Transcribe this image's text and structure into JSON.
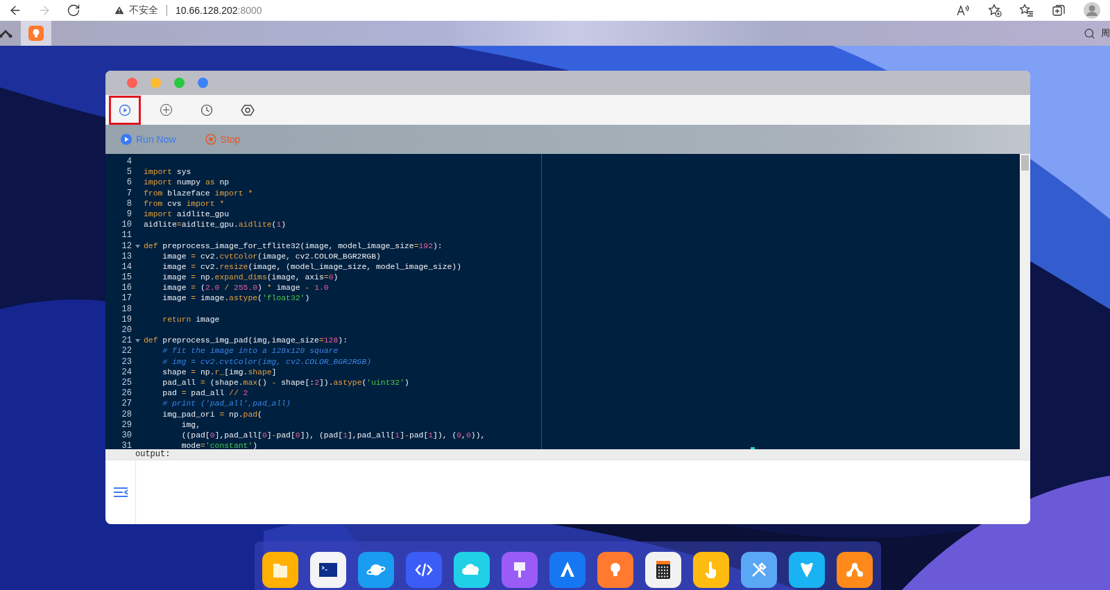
{
  "browser": {
    "nav": [
      {
        "kind": "back",
        "disabled": false
      },
      {
        "kind": "forward",
        "disabled": true
      },
      {
        "kind": "reload",
        "disabled": false
      }
    ],
    "address": {
      "security": "不安全",
      "host": "10.66.128.202",
      "port": ":8000"
    }
  },
  "tab_strip": {
    "tabs": [
      {
        "kind": "bulb",
        "selected": true
      }
    ],
    "search_text": "周"
  },
  "window": {
    "toolbar": [
      {
        "kind": "run",
        "selected": true
      },
      {
        "kind": "add",
        "selected": false
      },
      {
        "kind": "history",
        "selected": false
      },
      {
        "kind": "settings",
        "selected": false
      }
    ],
    "actions": [
      {
        "kind": "run",
        "label": "Run Now"
      },
      {
        "kind": "stop",
        "label": "Stop"
      }
    ],
    "editor": {
      "lines": [
        {
          "no": "4"
        },
        {
          "no": "5",
          "segments": [
            {
              "text": "import",
              "kind": "kw"
            },
            {
              "text": " sys"
            }
          ]
        },
        {
          "no": "6",
          "segments": [
            {
              "text": "import",
              "kind": "kw"
            },
            {
              "text": " numpy "
            },
            {
              "text": "as",
              "kind": "kw"
            },
            {
              "text": " np"
            }
          ]
        },
        {
          "no": "7",
          "segments": [
            {
              "text": "from",
              "kind": "kw"
            },
            {
              "text": " blazeface "
            },
            {
              "text": "import",
              "kind": "kw"
            },
            {
              "text": " *",
              "kind": "kw"
            }
          ]
        },
        {
          "no": "8",
          "segments": [
            {
              "text": "from",
              "kind": "kw"
            },
            {
              "text": " cvs "
            },
            {
              "text": "import",
              "kind": "kw"
            },
            {
              "text": " *",
              "kind": "kw"
            }
          ]
        },
        {
          "no": "9",
          "segments": [
            {
              "text": "import",
              "kind": "kw"
            },
            {
              "text": " aidlite_gpu"
            }
          ]
        },
        {
          "no": "10",
          "segments": [
            {
              "text": "aidlite"
            },
            {
              "text": "=",
              "kind": "kw"
            },
            {
              "text": "aidlite_gpu."
            },
            {
              "text": "aidlite",
              "kind": "kw"
            },
            {
              "text": "("
            },
            {
              "text": "1",
              "kind": "num"
            },
            {
              "text": ")"
            }
          ]
        },
        {
          "no": "11"
        },
        {
          "no": "12",
          "fold": true,
          "segments": [
            {
              "text": "def",
              "kind": "kw"
            },
            {
              "text": " preprocess_image_for_tflite32(image, model_image_size"
            },
            {
              "text": "=",
              "kind": "kw"
            },
            {
              "text": "192",
              "kind": "num"
            },
            {
              "text": "):"
            }
          ]
        },
        {
          "no": "13",
          "segments": [
            {
              "text": "    image "
            },
            {
              "text": "=",
              "kind": "kw"
            },
            {
              "text": " cv2."
            },
            {
              "text": "cvtColor",
              "kind": "kw"
            },
            {
              "text": "(image, cv2.COLOR_BGR2RGB)"
            }
          ]
        },
        {
          "no": "14",
          "segments": [
            {
              "text": "    image "
            },
            {
              "text": "=",
              "kind": "kw"
            },
            {
              "text": " cv2."
            },
            {
              "text": "resize",
              "kind": "kw"
            },
            {
              "text": "(image, (model_image_size, model_image_size))"
            }
          ]
        },
        {
          "no": "15",
          "segments": [
            {
              "text": "    image "
            },
            {
              "text": "=",
              "kind": "kw"
            },
            {
              "text": " np."
            },
            {
              "text": "expand_dims",
              "kind": "kw"
            },
            {
              "text": "(image, axis"
            },
            {
              "text": "=",
              "kind": "kw"
            },
            {
              "text": "0",
              "kind": "num"
            },
            {
              "text": ")"
            }
          ]
        },
        {
          "no": "16",
          "segments": [
            {
              "text": "    image "
            },
            {
              "text": "=",
              "kind": "kw"
            },
            {
              "text": " ("
            },
            {
              "text": "2.0",
              "kind": "num"
            },
            {
              "text": " / ",
              "kind": "kw"
            },
            {
              "text": "255.0",
              "kind": "num"
            },
            {
              "text": ") "
            },
            {
              "text": "*",
              "kind": "kw"
            },
            {
              "text": " image "
            },
            {
              "text": "-",
              "kind": "kw"
            },
            {
              "text": " 1.0",
              "kind": "num"
            }
          ]
        },
        {
          "no": "17",
          "segments": [
            {
              "text": "    image "
            },
            {
              "text": "=",
              "kind": "kw"
            },
            {
              "text": " image."
            },
            {
              "text": "astype",
              "kind": "kw"
            },
            {
              "text": "("
            },
            {
              "text": "'float32'",
              "kind": "str"
            },
            {
              "text": ")"
            }
          ]
        },
        {
          "no": "18"
        },
        {
          "no": "19",
          "segments": [
            {
              "text": "    return",
              "kind": "kw"
            },
            {
              "text": " image"
            }
          ]
        },
        {
          "no": "20"
        },
        {
          "no": "21",
          "fold": true,
          "segments": [
            {
              "text": "def",
              "kind": "kw"
            },
            {
              "text": " preprocess_img_pad(img,image_size"
            },
            {
              "text": "=",
              "kind": "kw"
            },
            {
              "text": "128",
              "kind": "num"
            },
            {
              "text": "):"
            }
          ]
        },
        {
          "no": "22",
          "segments": [
            {
              "text": "    # fit the image into a 128x128 square",
              "kind": "cm"
            }
          ]
        },
        {
          "no": "23",
          "segments": [
            {
              "text": "    # img = cv2.cvtColor(img, cv2.COLOR_BGR2RGB)",
              "kind": "cm"
            }
          ]
        },
        {
          "no": "24",
          "segments": [
            {
              "text": "    shape "
            },
            {
              "text": "=",
              "kind": "kw"
            },
            {
              "text": " np."
            },
            {
              "text": "r_",
              "kind": "kw"
            },
            {
              "text": "[img."
            },
            {
              "text": "shape",
              "kind": "kw"
            },
            {
              "text": "]"
            }
          ]
        },
        {
          "no": "25",
          "segments": [
            {
              "text": "    pad_all "
            },
            {
              "text": "=",
              "kind": "kw"
            },
            {
              "text": " (shape."
            },
            {
              "text": "max",
              "kind": "kw"
            },
            {
              "text": "() "
            },
            {
              "text": "-",
              "kind": "kw"
            },
            {
              "text": " shape[:"
            },
            {
              "text": "2",
              "kind": "num"
            },
            {
              "text": "])."
            },
            {
              "text": "astype",
              "kind": "kw"
            },
            {
              "text": "("
            },
            {
              "text": "'uint32'",
              "kind": "str"
            },
            {
              "text": ")"
            }
          ]
        },
        {
          "no": "26",
          "segments": [
            {
              "text": "    pad "
            },
            {
              "text": "=",
              "kind": "kw"
            },
            {
              "text": " pad_all "
            },
            {
              "text": "//",
              "kind": "kw"
            },
            {
              "text": " 2",
              "kind": "num"
            }
          ]
        },
        {
          "no": "27",
          "segments": [
            {
              "text": "    # print ('pad_all',pad_all)",
              "kind": "cm"
            }
          ]
        },
        {
          "no": "28",
          "segments": [
            {
              "text": "    img_pad_ori "
            },
            {
              "text": "=",
              "kind": "kw"
            },
            {
              "text": " np."
            },
            {
              "text": "pad",
              "kind": "kw"
            },
            {
              "text": "("
            }
          ]
        },
        {
          "no": "29",
          "segments": [
            {
              "text": "        img,"
            }
          ]
        },
        {
          "no": "30",
          "segments": [
            {
              "text": "        ((pad["
            },
            {
              "text": "0",
              "kind": "num"
            },
            {
              "text": "],pad_all["
            },
            {
              "text": "0",
              "kind": "num"
            },
            {
              "text": "]"
            },
            {
              "text": "-",
              "kind": "kw"
            },
            {
              "text": "pad["
            },
            {
              "text": "0",
              "kind": "num"
            },
            {
              "text": "]), (pad["
            },
            {
              "text": "1",
              "kind": "num"
            },
            {
              "text": "],pad_all["
            },
            {
              "text": "1",
              "kind": "num"
            },
            {
              "text": "]"
            },
            {
              "text": "-",
              "kind": "kw"
            },
            {
              "text": "pad["
            },
            {
              "text": "1",
              "kind": "num"
            },
            {
              "text": "]), ("
            },
            {
              "text": "0",
              "kind": "num"
            },
            {
              "text": ","
            },
            {
              "text": "0",
              "kind": "num"
            },
            {
              "text": ")),"
            }
          ]
        },
        {
          "no": "31",
          "segments": [
            {
              "text": "        mode"
            },
            {
              "text": "=",
              "kind": "kw"
            },
            {
              "text": "'constant'",
              "kind": "str"
            },
            {
              "text": ")"
            }
          ]
        }
      ]
    },
    "output": {
      "label": "output:"
    }
  },
  "dock": {
    "apps": [
      {
        "color": "#ffb000"
      },
      {
        "color": "#f4f4f6"
      },
      {
        "color": "#1a9cf0"
      },
      {
        "color": "#3b5cf5"
      },
      {
        "color": "#1fd0e6"
      },
      {
        "color": "#9a5cf6"
      },
      {
        "color": "#1677f2"
      },
      {
        "color": "#ff7a2e"
      },
      {
        "color": "#f2f2f2"
      },
      {
        "color": "#ffbb10"
      },
      {
        "color": "#5aa8f5"
      },
      {
        "color": "#19b2f2"
      },
      {
        "color": "#ff8a1a"
      }
    ]
  }
}
